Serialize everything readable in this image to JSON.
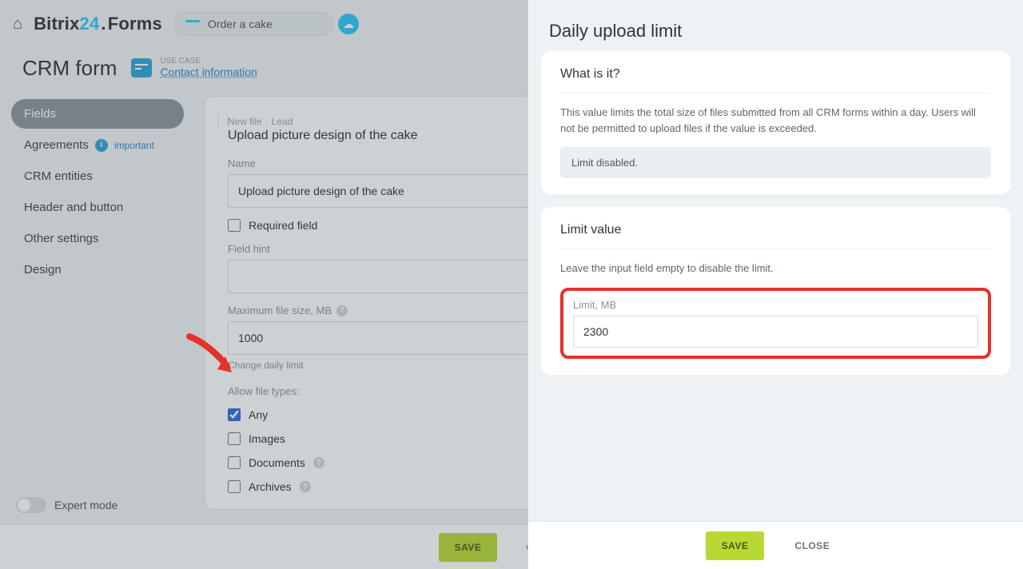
{
  "topbar": {
    "brand_prefix": "Bitrix",
    "brand_num": "24",
    "brand_suffix": "Forms",
    "order_label": "Order a cake"
  },
  "subheader": {
    "title": "CRM form",
    "usecase_label": "USE CASE",
    "usecase_link": "Contact information"
  },
  "sidebar": {
    "items": [
      {
        "label": "Fields"
      },
      {
        "label": "Agreements"
      },
      {
        "label": "CRM entities"
      },
      {
        "label": "Header and button"
      },
      {
        "label": "Other settings"
      },
      {
        "label": "Design"
      }
    ],
    "important": "important"
  },
  "card": {
    "crumb_a": "New file",
    "crumb_b": "Lead",
    "title": "Upload picture design of the cake",
    "name_label": "Name",
    "name_value": "Upload picture design of the cake",
    "required_label": "Required field",
    "hint_label": "Field hint",
    "max_label": "Maximum file size, MB",
    "max_value": "1000",
    "change_link": "Change daily limit",
    "types_label": "Allow file types:",
    "opt_any": "Any",
    "opt_images": "Images",
    "opt_docs": "Documents",
    "opt_arch": "Archives"
  },
  "expert": {
    "label": "Expert mode"
  },
  "footer": {
    "save": "Save",
    "cancel": "Cancel"
  },
  "panel": {
    "title": "Daily upload limit",
    "what_title": "What is it?",
    "what_text": "This value limits the total size of files submitted from all CRM forms within a day. Users will not be permitted to upload files if the value is exceeded.",
    "disabled": "Limit disabled.",
    "limit_title": "Limit value",
    "limit_hint": "Leave the input field empty to disable the limit.",
    "limit_label": "Limit, MB",
    "limit_value": "2300",
    "save": "Save",
    "close": "Close"
  }
}
